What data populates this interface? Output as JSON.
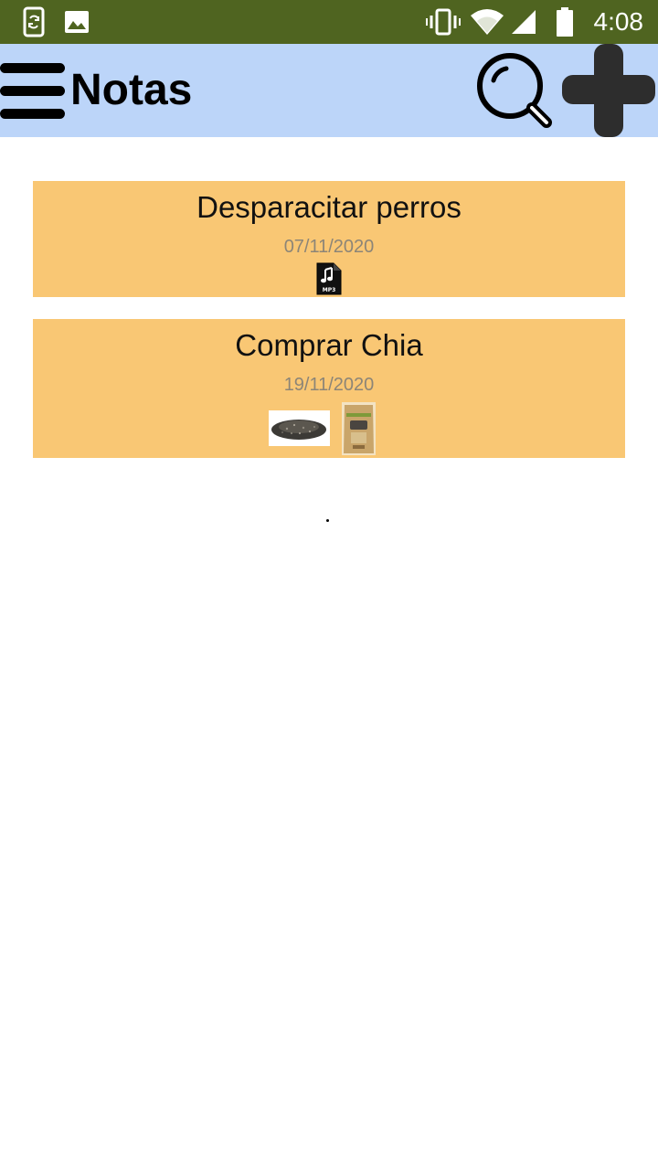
{
  "status_bar": {
    "time": "4:08",
    "background_color": "#4f6420",
    "left_icons": [
      "phone-sync-icon",
      "image-icon"
    ],
    "right_icons": [
      "vibrate-icon",
      "wifi-icon",
      "cellular-signal-icon",
      "battery-icon"
    ]
  },
  "app_bar": {
    "title": "Notas",
    "background_color": "#bcd5f9",
    "menu_icon": "hamburger-menu-icon",
    "search_icon": "search-icon",
    "add_icon": "plus-icon"
  },
  "notes": [
    {
      "title": "Desparacitar perros",
      "date": "07/11/2020",
      "attachments": [
        "mp3-file-icon"
      ]
    },
    {
      "title": "Comprar Chia",
      "date": "19/11/2020",
      "attachments": [
        "chia-seeds-image",
        "chia-bag-image"
      ]
    }
  ],
  "colors": {
    "note_card": "#f9c774",
    "date_text": "#8c8577"
  }
}
